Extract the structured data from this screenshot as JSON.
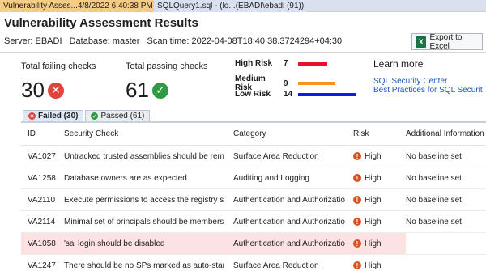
{
  "tabs": [
    {
      "label": "Vulnerability Asses...4/8/2022 6:40:38 PM",
      "pin": "⊣",
      "close": "✕"
    },
    {
      "label": "SQLQuery1.sql - (lo...(EBADI\\ebadi (91))"
    }
  ],
  "header": {
    "title": "Vulnerability Assessment Results",
    "server": "Server: EBADI",
    "database": "Database: master",
    "scan_time": "Scan time: 2022-04-08T18:40:38.3724294+04:30",
    "export_label": "Export to Excel"
  },
  "summary": {
    "failing_label": "Total failing checks",
    "failing_count": "30",
    "passing_label": "Total passing checks",
    "passing_count": "61",
    "risks": [
      {
        "name": "High Risk",
        "count": "7",
        "color": "#e81123",
        "fraction": 0.5
      },
      {
        "name": "Medium Risk",
        "count": "9",
        "color": "#f7931e",
        "fraction": 0.643
      },
      {
        "name": "Low Risk",
        "count": "14",
        "color": "#0a1ee0",
        "fraction": 1.0
      }
    ]
  },
  "learn": {
    "title": "Learn more",
    "links": [
      "SQL Security Center",
      "Best Practices for SQL Securit"
    ]
  },
  "result_tabs": [
    {
      "label": "Failed  (30)",
      "status": "failed",
      "active": true
    },
    {
      "label": "Passed  (61)",
      "status": "passed",
      "active": false
    }
  ],
  "table": {
    "columns": [
      "ID",
      "Security Check",
      "Category",
      "Risk",
      "Additional Information"
    ],
    "rows": [
      {
        "id": "VA1027",
        "check": "Untracked trusted assemblies should be remove",
        "category": "Surface Area Reduction",
        "risk": "High",
        "info": "No baseline set"
      },
      {
        "id": "VA1258",
        "check": "Database owners are as expected",
        "category": "Auditing and Logging",
        "risk": "High",
        "info": "No baseline set"
      },
      {
        "id": "VA2110",
        "check": "Execute permissions to access the registry shoul",
        "category": "Authentication and Authorization",
        "risk": "High",
        "info": "No baseline set"
      },
      {
        "id": "VA2114",
        "check": "Minimal set of principals should be members of",
        "category": "Authentication and Authorization",
        "risk": "High",
        "info": "No baseline set"
      },
      {
        "id": "VA1058",
        "check": "'sa' login should be disabled",
        "category": "Authentication and Authorization",
        "risk": "High",
        "info": "",
        "selected": true
      },
      {
        "id": "VA1247",
        "check": "There should be no SPs marked as auto-start",
        "category": "Surface Area Reduction",
        "risk": "High",
        "info": ""
      }
    ]
  }
}
